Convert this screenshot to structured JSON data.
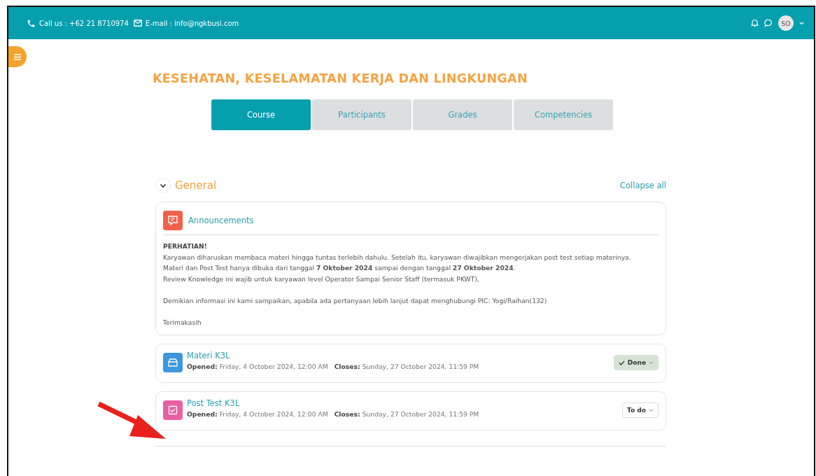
{
  "header": {
    "phone": "Call us : +62 21 8710974",
    "email": "E-mail : info@ngkbusi.com",
    "avatar": "SO"
  },
  "course_title": "KESEHATAN, KESELAMATAN KERJA DAN LINGKUNGAN",
  "tabs": [
    {
      "label": "Course",
      "selected": true
    },
    {
      "label": "Participants",
      "selected": false
    },
    {
      "label": "Grades",
      "selected": false
    },
    {
      "label": "Competencies",
      "selected": false
    }
  ],
  "section": {
    "title": "General",
    "expanded": true,
    "collapse_link": "Collapse all"
  },
  "announcement": {
    "title": "Announcements",
    "heading": "PERHATIAN!",
    "paragraphs": [
      [
        "Karyawan diharuskan membaca materi hingga tuntas terlebih dahulu. Setelah itu, karyawan diwajibkan mengerjakan post test setiap materinya.",
        "Materi dan Post Test hanya dibuka dari tanggal **7 Oktober 2024** sampai dengan tanggal **27 Oktober 2024**.",
        "Review Knowledge ini wajib untuk karyawan level Operator Sampai Senior Staff (termasuk PKWT),"
      ],
      [
        "Demikian informasi ini kami sampaikan, apabila ada pertanyaan lebih lanjut dapat menghubungi PIC: Yogi/Raihan(132)"
      ],
      [
        "Terimakasih"
      ]
    ]
  },
  "activities": [
    {
      "kind": "page",
      "title": "Materi K3L",
      "opened_label": "Opened:",
      "opened": "Friday, 4 October 2024, 12:00 AM",
      "closes_label": "Closes:",
      "closes": "Sunday, 27 October 2024, 11:59 PM",
      "status": "Done",
      "completed": true
    },
    {
      "kind": "quiz",
      "title": "Post Test K3L",
      "opened_label": "Opened:",
      "opened": "Friday, 4 October 2024, 12:00 AM",
      "closes_label": "Closes:",
      "closes": "Sunday, 27 October 2024, 11:59 PM",
      "status": "To do",
      "completed": false
    }
  ]
}
